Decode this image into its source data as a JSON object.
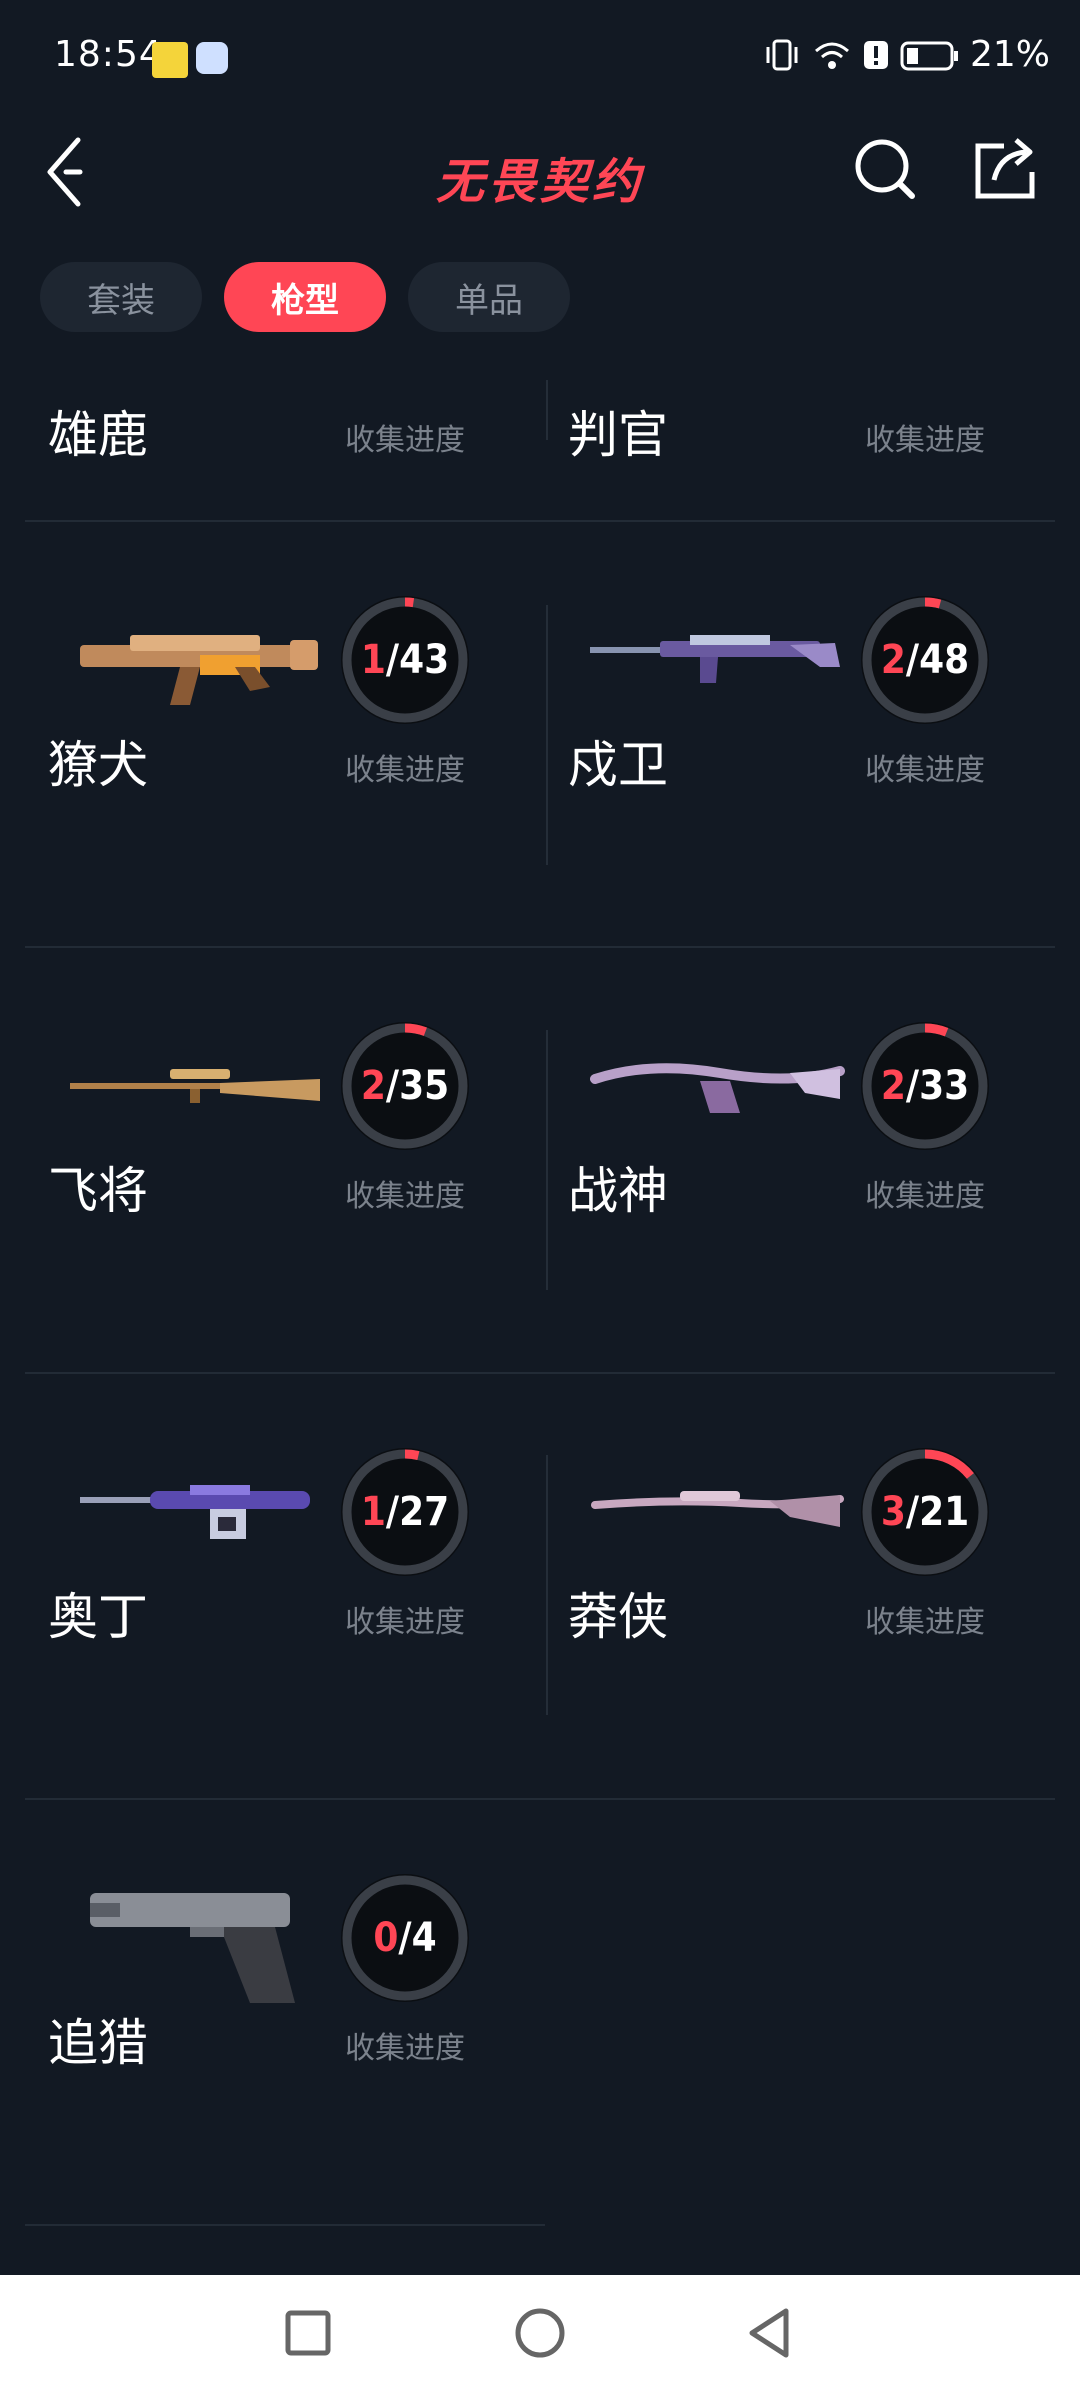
{
  "status": {
    "time": "18:54",
    "battery": "21%"
  },
  "header": {
    "title": "无畏契约"
  },
  "tabs": [
    {
      "label": "套装",
      "active": false
    },
    {
      "label": "枪型",
      "active": true
    },
    {
      "label": "单品",
      "active": false
    }
  ],
  "progress_label": "收集进度",
  "partial_row": [
    {
      "name": "雄鹿",
      "label": "收集进度"
    },
    {
      "name": "判官",
      "label": "收集进度"
    }
  ],
  "weapons": [
    {
      "name": "獠犬",
      "collected": 1,
      "total": 43,
      "label": "收集进度",
      "icon": "bulldog-rifle-icon"
    },
    {
      "name": "戍卫",
      "collected": 2,
      "total": 48,
      "label": "收集进度",
      "icon": "guardian-rifle-icon"
    },
    {
      "name": "飞将",
      "collected": 2,
      "total": 35,
      "label": "收集进度",
      "icon": "marshal-sniper-icon"
    },
    {
      "name": "战神",
      "collected": 2,
      "total": 33,
      "label": "收集进度",
      "icon": "ares-mg-icon"
    },
    {
      "name": "奥丁",
      "collected": 1,
      "total": 27,
      "label": "收集进度",
      "icon": "odin-mg-icon"
    },
    {
      "name": "莽侠",
      "collected": 3,
      "total": 21,
      "label": "收集进度",
      "icon": "outlaw-sniper-icon"
    },
    {
      "name": "追猎",
      "collected": 0,
      "total": 4,
      "label": "收集进度",
      "icon": "pistol-icon"
    }
  ],
  "colors": {
    "accent": "#ff4655",
    "background": "#121923",
    "ring_track": "#3a3f47"
  }
}
